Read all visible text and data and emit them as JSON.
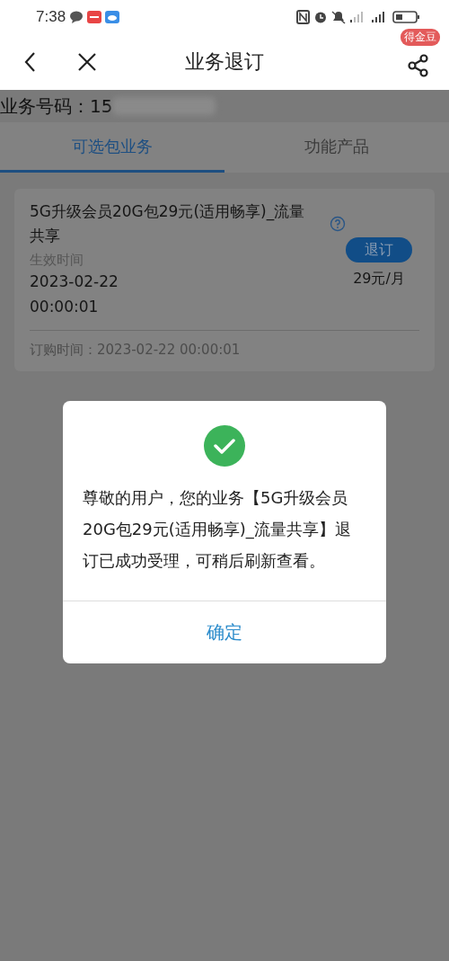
{
  "status_bar": {
    "time": "7:38"
  },
  "header": {
    "title": "业务退订",
    "badge": "得金豆"
  },
  "account": {
    "label": "业务号码：15"
  },
  "tabs": [
    {
      "label": "可选包业务",
      "selected": true
    },
    {
      "label": "功能产品",
      "selected": false
    }
  ],
  "package": {
    "name": "5G升级会员20G包29元(适用畅享)_流量共享",
    "effective_label": "生效时间",
    "effective_date": "2023-02-22",
    "effective_time": "00:00:01",
    "button": "退订",
    "price": "29元/月",
    "order_time": "订购时间：2023-02-22 00:00:01"
  },
  "dialog": {
    "message": "尊敬的用户，您的业务【5G升级会员20G包29元(适用畅享)_流量共享】退订已成功受理，可稍后刷新查看。",
    "button": "确定"
  }
}
